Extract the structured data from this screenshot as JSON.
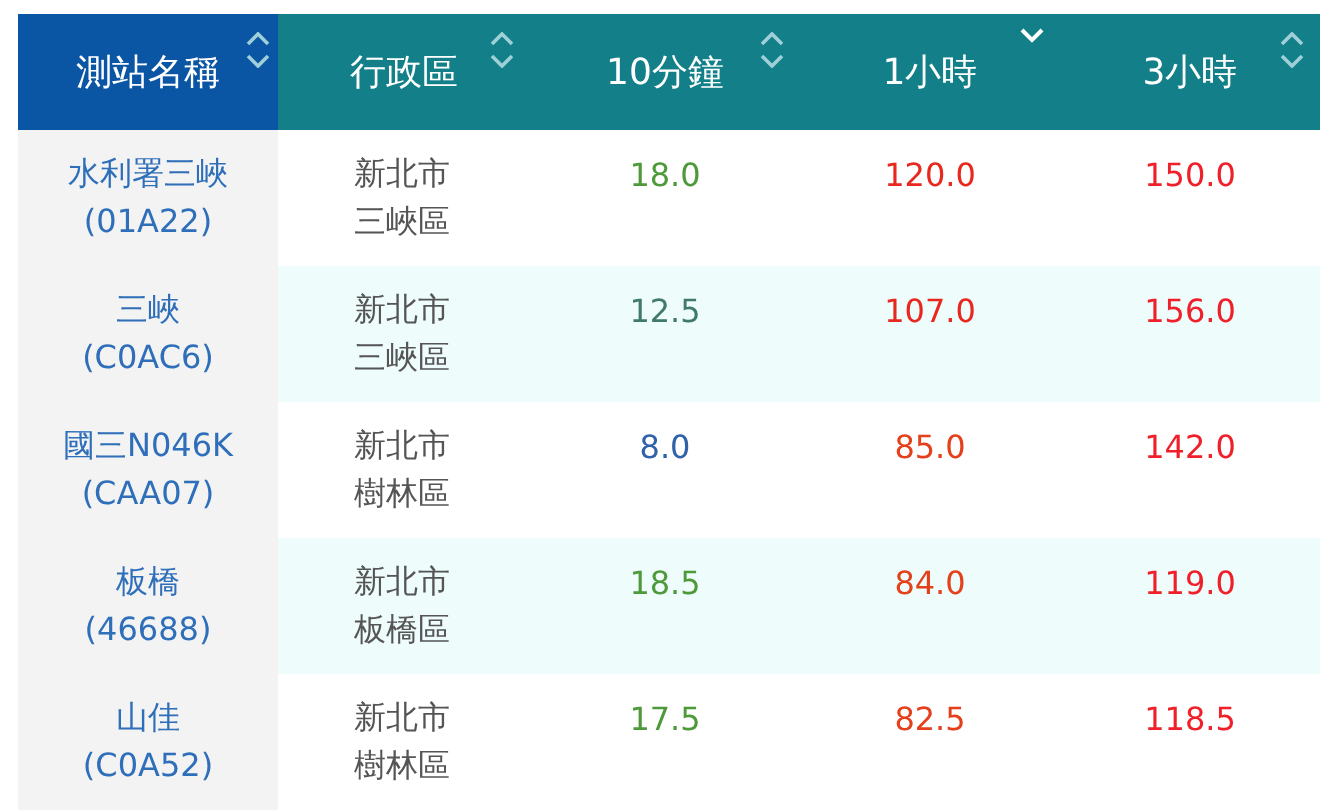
{
  "table": {
    "columns": [
      {
        "label": "測站名稱",
        "selected": true,
        "sorted": false
      },
      {
        "label": "行政區",
        "selected": false,
        "sorted": false
      },
      {
        "label": "10分鐘",
        "selected": false,
        "sorted": false
      },
      {
        "label": "1小時",
        "selected": false,
        "sorted": true
      },
      {
        "label": "3小時",
        "selected": false,
        "sorted": false
      }
    ],
    "rows": [
      {
        "station": "水利署三峽",
        "code": "(01A22)",
        "city": "新北市",
        "district": "三峽區",
        "values": [
          {
            "text": "18.0",
            "color": "#4e9a3a"
          },
          {
            "text": "120.0",
            "color": "#e8281e"
          },
          {
            "text": "150.0",
            "color": "#f0202a"
          }
        ]
      },
      {
        "station": "三峽",
        "code": "(C0AC6)",
        "city": "新北市",
        "district": "三峽區",
        "values": [
          {
            "text": "12.5",
            "color": "#3f7a6a"
          },
          {
            "text": "107.0",
            "color": "#e8281e"
          },
          {
            "text": "156.0",
            "color": "#f0202a"
          }
        ]
      },
      {
        "station": "國三N046K",
        "code": "(CAA07)",
        "city": "新北市",
        "district": "樹林區",
        "values": [
          {
            "text": "8.0",
            "color": "#2f62a8"
          },
          {
            "text": "85.0",
            "color": "#e4401c"
          },
          {
            "text": "142.0",
            "color": "#f0202a"
          }
        ]
      },
      {
        "station": "板橋",
        "code": "(46688)",
        "city": "新北市",
        "district": "板橋區",
        "values": [
          {
            "text": "18.5",
            "color": "#4e9a3a"
          },
          {
            "text": "84.0",
            "color": "#e4401c"
          },
          {
            "text": "119.0",
            "color": "#f0202a"
          }
        ]
      },
      {
        "station": "山佳",
        "code": "(C0A52)",
        "city": "新北市",
        "district": "樹林區",
        "values": [
          {
            "text": "17.5",
            "color": "#4e9a3a"
          },
          {
            "text": "82.5",
            "color": "#e4401c"
          },
          {
            "text": "118.5",
            "color": "#f0202a"
          }
        ]
      }
    ]
  }
}
